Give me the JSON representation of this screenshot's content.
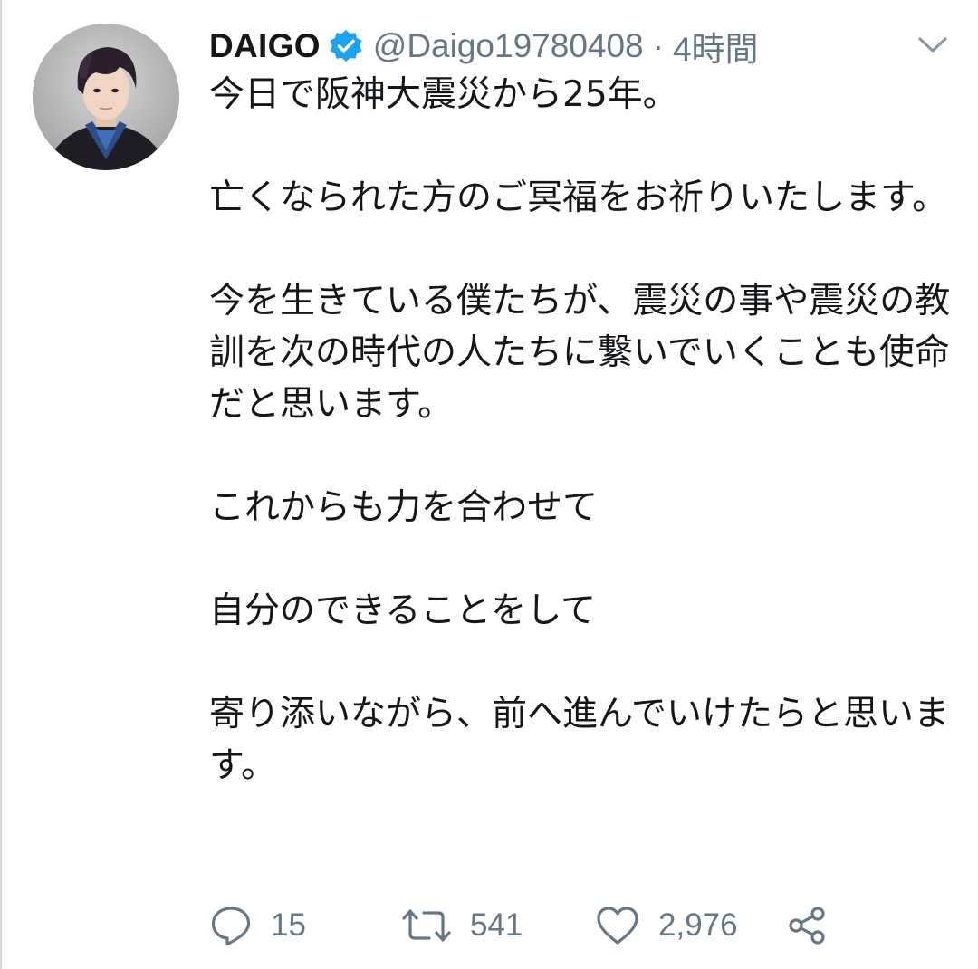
{
  "tweet": {
    "display_name": "DAIGO",
    "verified": true,
    "handle": "@Daigo19780408",
    "separator": "·",
    "time": "4時間",
    "paragraphs": [
      "今日で阪神大震災から25年。",
      "亡くなられた方のご冥福をお祈りいたします。",
      "今を生きている僕たちが、震災の事や震災の教訓を次の時代の人たちに繋いでいくことも使命だと思います。",
      "これからも力を合わせて",
      "自分のできることをして",
      "寄り添いながら、前へ進んでいけたらと思います。"
    ]
  },
  "actions": {
    "reply_count": "15",
    "retweet_count": "541",
    "like_count": "2,976"
  },
  "icons": {
    "verified": "verified-badge-icon",
    "caret": "chevron-down-icon",
    "reply": "reply-icon",
    "retweet": "retweet-icon",
    "like": "heart-icon",
    "share": "share-icon"
  },
  "colors": {
    "text": "#14171a",
    "secondary": "#657786",
    "verified_blue": "#1da1f2"
  }
}
